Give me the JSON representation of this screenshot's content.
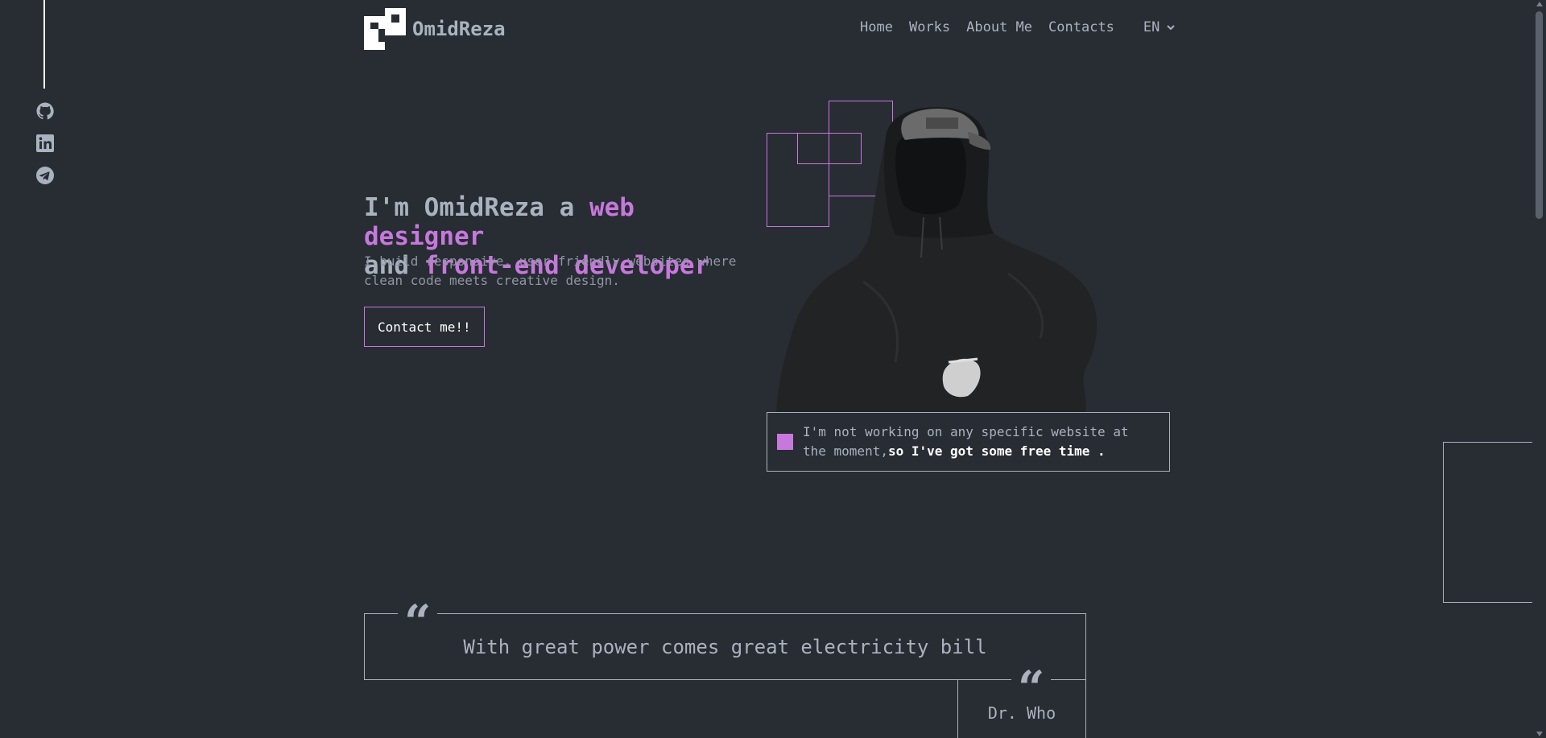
{
  "brand": {
    "name": "OmidReza"
  },
  "nav": {
    "items": [
      "Home",
      "Works",
      "About Me",
      "Contacts"
    ],
    "language": "EN"
  },
  "social": [
    "github-icon",
    "linkedin-icon",
    "telegram-icon"
  ],
  "hero": {
    "title_prefix": "I'm OmidReza a ",
    "title_accent1": "web designer",
    "title_mid": "and ",
    "title_accent2": "front-end developer",
    "subtitle": "I build responsive, user-friendly websites where clean code meets creative design.",
    "cta": "Contact me!!"
  },
  "status": {
    "text": "I'm not working on any specific website at the moment,",
    "bold": "so I've got some free time ."
  },
  "quote": {
    "text": "With great power comes great electricity bill",
    "author": "Dr. Who",
    "mark": "“"
  },
  "colors": {
    "background": "#282c33",
    "accent": "#c778dd",
    "text": "#abb2bf",
    "white": "#ffffff"
  }
}
